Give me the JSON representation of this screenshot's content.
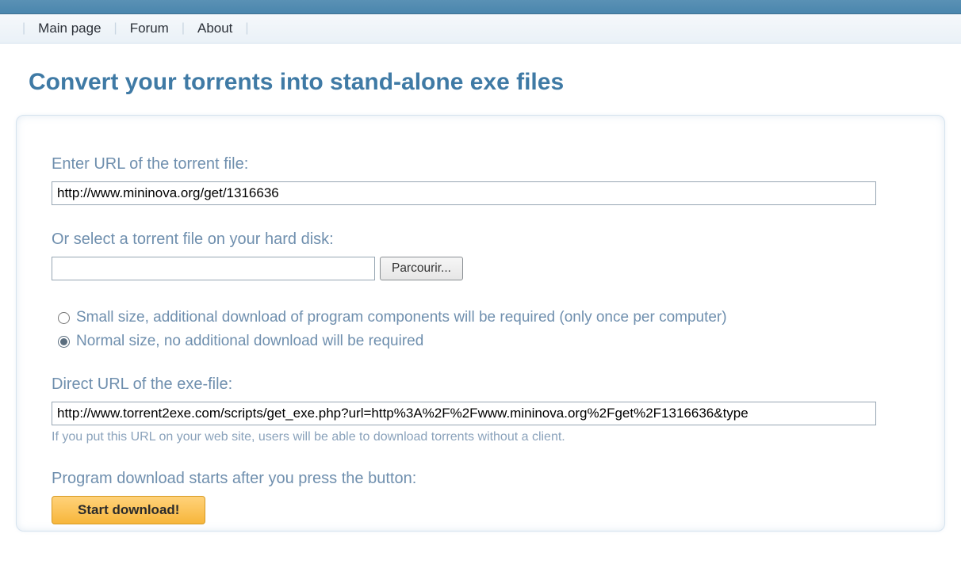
{
  "nav": {
    "main_page": "Main page",
    "forum": "Forum",
    "about": "About"
  },
  "page": {
    "title": "Convert your torrents into stand-alone exe files"
  },
  "form": {
    "url_label": "Enter URL of the torrent file:",
    "url_value": "http://www.mininova.org/get/1316636",
    "file_label": "Or select a torrent file on your hard disk:",
    "file_value": "",
    "browse_label": "Parcourir...",
    "size_options": {
      "small": "Small size, additional download of program components will be required (only once per computer)",
      "normal": "Normal size, no additional download will be required",
      "selected": "normal"
    },
    "direct_url_label": "Direct URL of the exe-file:",
    "direct_url_value": "http://www.torrent2exe.com/scripts/get_exe.php?url=http%3A%2F%2Fwww.mininova.org%2Fget%2F1316636&type",
    "direct_url_note": "If you put this URL on your web site, users will be able to download torrents without a client.",
    "start_label": "Program download starts after you press the button:",
    "start_button": "Start download!"
  }
}
